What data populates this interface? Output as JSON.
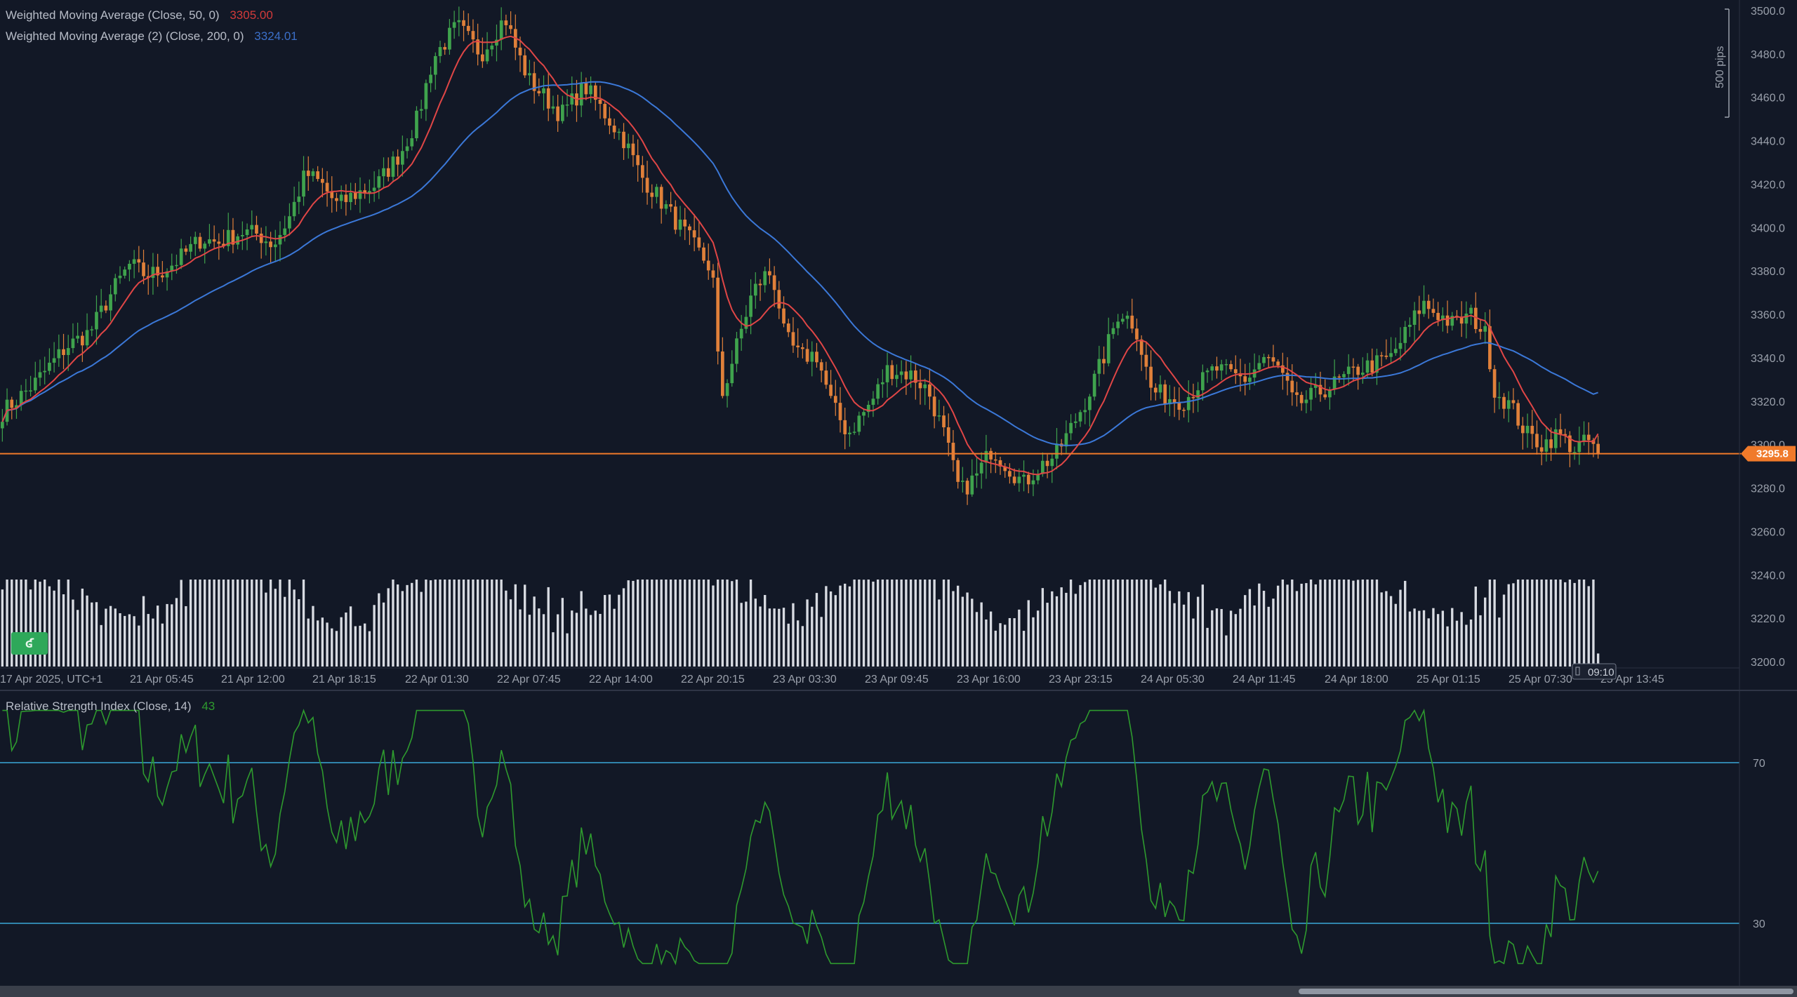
{
  "legend": {
    "wma50_label": "Weighted Moving Average (Close, 50, 0)",
    "wma50_value": "3305.00",
    "wma200_label": "Weighted Moving Average (2) (Close, 200, 0)",
    "wma200_value": "3324.01",
    "rsi_label": "Relative Strength Index (Close, 14)",
    "rsi_value": "43"
  },
  "price_tag": "3295.8",
  "pips_label": "500 pips",
  "time_box": "09:10",
  "colors": {
    "background": "#121826",
    "up_candle": "#3fa34d",
    "down_candle": "#e0803a",
    "wma50": "#e04646",
    "wma200": "#3b78d8",
    "price_line": "#f07a2a",
    "volume": "#d8dbe2",
    "rsi": "#2e9a2e",
    "rsi_levels": "#3aa7d8"
  },
  "chart_data": [
    {
      "type": "candlestick",
      "title": "",
      "y_axis": {
        "ticks": [
          "3200.0",
          "3220.0",
          "3240.0",
          "3260.0",
          "3280.0",
          "3300.0",
          "3320.0",
          "3340.0",
          "3360.0",
          "3380.0",
          "3400.0",
          "3420.0",
          "3440.0",
          "3460.0",
          "3480.0",
          "3500.0"
        ],
        "range": [
          3195,
          3505
        ]
      },
      "x_axis": {
        "labels": [
          "17 Apr 2025, UTC+1",
          "21 Apr 05:45",
          "21 Apr 12:00",
          "21 Apr 18:15",
          "22 Apr 01:30",
          "22 Apr 07:45",
          "22 Apr 14:00",
          "22 Apr 20:15",
          "23 Apr 03:30",
          "23 Apr 09:45",
          "23 Apr 16:00",
          "23 Apr 23:15",
          "24 Apr 05:30",
          "24 Apr 11:45",
          "24 Apr 18:00",
          "25 Apr 01:15",
          "25 Apr 07:30",
          "25 Apr 13:45"
        ]
      },
      "current_price": 3295.8,
      "close_path": [
        [
          0,
          3315
        ],
        [
          20,
          3328
        ],
        [
          40,
          3345
        ],
        [
          55,
          3352
        ],
        [
          70,
          3372
        ],
        [
          80,
          3383
        ],
        [
          90,
          3378
        ],
        [
          100,
          3380
        ],
        [
          110,
          3385
        ],
        [
          125,
          3395
        ],
        [
          135,
          3393
        ],
        [
          150,
          3398
        ],
        [
          160,
          3397
        ],
        [
          170,
          3392
        ],
        [
          180,
          3405
        ],
        [
          190,
          3425
        ],
        [
          200,
          3420
        ],
        [
          210,
          3410
        ],
        [
          220,
          3415
        ],
        [
          235,
          3420
        ],
        [
          250,
          3435
        ],
        [
          260,
          3450
        ],
        [
          270,
          3478
        ],
        [
          285,
          3493
        ],
        [
          300,
          3480
        ],
        [
          315,
          3497
        ],
        [
          322,
          3482
        ],
        [
          330,
          3468
        ],
        [
          340,
          3460
        ],
        [
          350,
          3452
        ],
        [
          365,
          3465
        ],
        [
          380,
          3450
        ],
        [
          390,
          3440
        ],
        [
          400,
          3424
        ],
        [
          410,
          3415
        ],
        [
          420,
          3405
        ],
        [
          430,
          3395
        ],
        [
          440,
          3385
        ],
        [
          445,
          3380
        ],
        [
          450,
          3320
        ],
        [
          460,
          3345
        ],
        [
          470,
          3370
        ],
        [
          480,
          3380
        ],
        [
          485,
          3372
        ],
        [
          490,
          3350
        ],
        [
          500,
          3340
        ],
        [
          510,
          3342
        ],
        [
          520,
          3318
        ],
        [
          530,
          3305
        ],
        [
          545,
          3320
        ],
        [
          555,
          3335
        ],
        [
          570,
          3332
        ],
        [
          580,
          3325
        ],
        [
          590,
          3305
        ],
        [
          600,
          3278
        ],
        [
          610,
          3285
        ],
        [
          620,
          3298
        ],
        [
          630,
          3290
        ],
        [
          640,
          3282
        ],
        [
          650,
          3290
        ],
        [
          660,
          3295
        ],
        [
          670,
          3308
        ],
        [
          680,
          3322
        ],
        [
          690,
          3340
        ],
        [
          700,
          3362
        ],
        [
          710,
          3355
        ],
        [
          720,
          3325
        ],
        [
          730,
          3322
        ],
        [
          740,
          3320
        ],
        [
          750,
          3328
        ],
        [
          760,
          3335
        ],
        [
          770,
          3332
        ],
        [
          780,
          3330
        ],
        [
          790,
          3340
        ],
        [
          800,
          3335
        ],
        [
          810,
          3318
        ],
        [
          820,
          3322
        ],
        [
          830,
          3326
        ],
        [
          840,
          3330
        ],
        [
          850,
          3335
        ],
        [
          860,
          3337
        ],
        [
          870,
          3340
        ],
        [
          880,
          3352
        ],
        [
          890,
          3365
        ],
        [
          900,
          3360
        ],
        [
          910,
          3355
        ],
        [
          920,
          3360
        ],
        [
          930,
          3350
        ],
        [
          935,
          3325
        ],
        [
          945,
          3318
        ],
        [
          955,
          3305
        ],
        [
          965,
          3300
        ],
        [
          975,
          3305
        ],
        [
          985,
          3298
        ],
        [
          995,
          3302
        ],
        [
          1000,
          3296
        ]
      ],
      "volume_range": [
        0,
        60
      ],
      "series": [
        {
          "name": "Weighted Moving Average (Close, 50, 0)",
          "last": 3305.0
        },
        {
          "name": "Weighted Moving Average (2) (Close, 200, 0)",
          "last": 3324.01
        }
      ]
    },
    {
      "type": "line",
      "title": "Relative Strength Index (Close, 14)",
      "y_axis": {
        "ticks": [
          "30",
          "70"
        ],
        "range": [
          20,
          85
        ]
      },
      "levels": [
        30,
        70
      ],
      "last": 43
    }
  ]
}
